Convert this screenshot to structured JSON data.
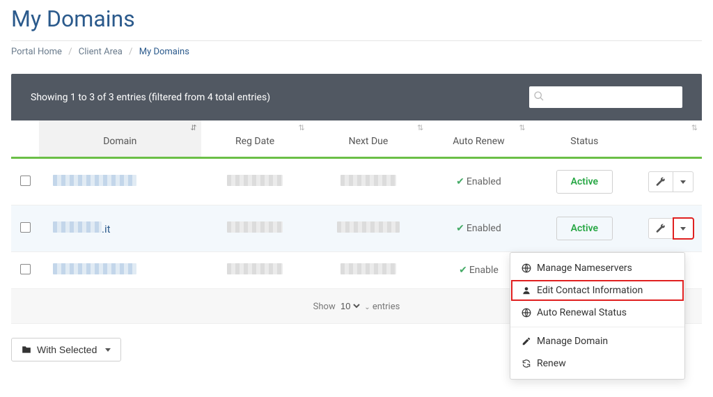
{
  "page": {
    "title": "My Domains"
  },
  "breadcrumb": {
    "home": "Portal Home",
    "area": "Client Area",
    "current": "My Domains"
  },
  "toolbar": {
    "info_text": "Showing 1 to 3 of 3 entries (filtered from 4 total entries)",
    "search_placeholder": ""
  },
  "columns": {
    "checkbox": "",
    "domain": "Domain",
    "reg_date": "Reg Date",
    "next_due": "Next Due",
    "auto_renew": "Auto Renew",
    "status": "Status",
    "actions": ""
  },
  "rows": [
    {
      "domain_text": "",
      "domain_suffix": "",
      "auto_renew": "Enabled",
      "status": "Active"
    },
    {
      "domain_text": "",
      "domain_suffix": ".it",
      "auto_renew": "Enabled",
      "status": "Active"
    },
    {
      "domain_text": "",
      "domain_suffix": "",
      "auto_renew": "Enable",
      "status": ""
    }
  ],
  "dropdown": {
    "manage_ns": "Manage Nameservers",
    "edit_contact": "Edit Contact Information",
    "auto_renewal": "Auto Renewal Status",
    "manage_domain": "Manage Domain",
    "renew": "Renew"
  },
  "footer": {
    "show_label": "Show",
    "entries_label": "entries",
    "page_size": "10"
  },
  "bulk_button": {
    "label": "With Selected"
  }
}
